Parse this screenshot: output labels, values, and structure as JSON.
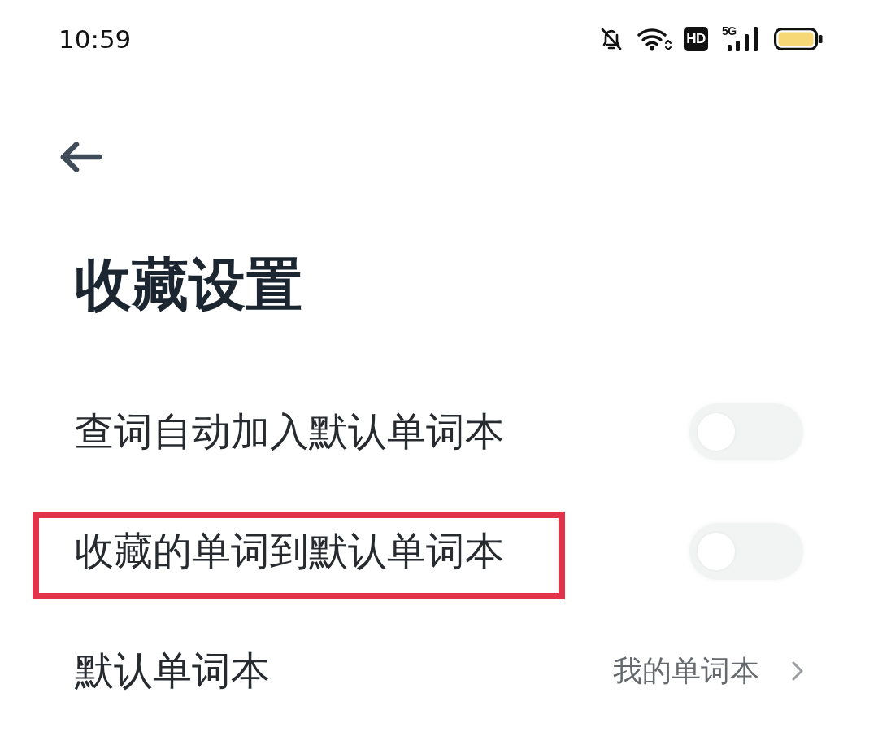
{
  "status_bar": {
    "time": "10:59",
    "hd": "HD",
    "network": "5G"
  },
  "header": {
    "title": "收藏设置"
  },
  "settings": [
    {
      "kind": "toggle",
      "label": "查词自动加入默认单词本",
      "on": false,
      "highlighted": false
    },
    {
      "kind": "toggle",
      "label": "收藏的单词到默认单词本",
      "on": false,
      "highlighted": true
    },
    {
      "kind": "link",
      "label": "默认单词本",
      "value": "我的单词本",
      "highlighted": false
    }
  ]
}
